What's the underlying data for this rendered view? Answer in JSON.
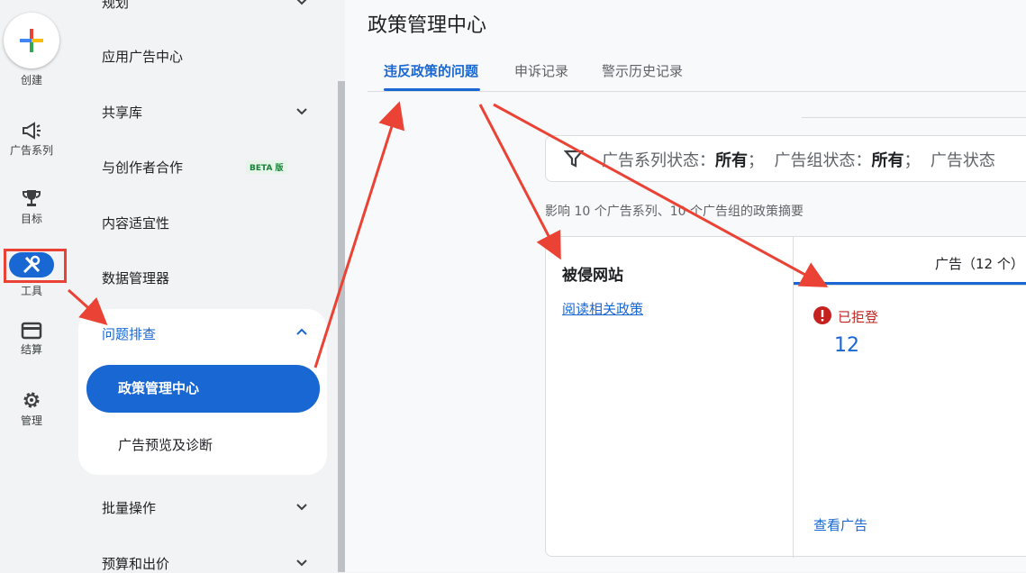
{
  "rail": {
    "create_label": "创建",
    "items": [
      {
        "label": "广告系列",
        "icon": "megaphone-icon"
      },
      {
        "label": "目标",
        "icon": "trophy-icon"
      },
      {
        "label": "工具",
        "icon": "tools-icon"
      },
      {
        "label": "结算",
        "icon": "credit-card-icon"
      },
      {
        "label": "管理",
        "icon": "gear-icon"
      }
    ]
  },
  "nav": {
    "top_partial": "规划",
    "items": [
      {
        "label": "应用广告中心"
      },
      {
        "label": "共享库"
      },
      {
        "label": "与创作者合作",
        "badge": "BETA 版"
      },
      {
        "label": "内容适宜性"
      },
      {
        "label": "数据管理器"
      },
      {
        "label": "问题排查"
      },
      {
        "label": "政策管理中心"
      },
      {
        "label": "广告预览及诊断"
      },
      {
        "label": "批量操作"
      },
      {
        "label": "预算和出价"
      }
    ]
  },
  "main": {
    "title": "政策管理中心",
    "tabs": [
      "违反政策的问题",
      "申诉记录",
      "警示历史记录"
    ],
    "filter": {
      "k1": "广告系列状态：",
      "v1": "所有",
      "k2": "广告组状态：",
      "v2": "所有",
      "k3": "广告状态"
    },
    "summary": "影响 10 个广告系列、10 个广告组的政策摘要",
    "card": {
      "left_title": "被侵网站",
      "left_link": "阅读相关政策",
      "ads_tab": "广告（12 个）",
      "status_label": "已拒登",
      "status_count": "12",
      "view_ads": "查看广告"
    }
  },
  "colors": {
    "accent": "#1967d2",
    "error": "#c5221f",
    "annotation": "#ea4335"
  }
}
